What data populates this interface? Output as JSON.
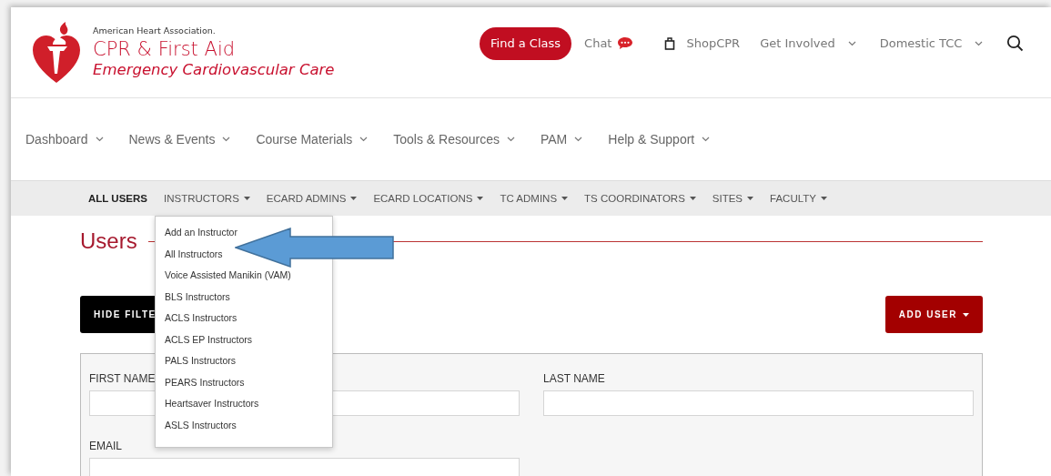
{
  "logo": {
    "org": "American Heart Association.",
    "title": "CPR & First Aid",
    "subtitle": "Emergency Cardiovascular Care"
  },
  "top_nav": [
    {
      "kind": "button",
      "label": "Find a Class"
    },
    {
      "kind": "chat",
      "label": "Chat"
    },
    {
      "kind": "shop",
      "label": "ShopCPR"
    },
    {
      "kind": "menu",
      "label": "Get Involved"
    },
    {
      "kind": "menu",
      "label": "Domestic TCC"
    },
    {
      "kind": "search"
    }
  ],
  "main_nav": [
    "Dashboard",
    "News & Events",
    "Course Materials",
    "Tools & Resources",
    "PAM",
    "Help & Support"
  ],
  "sub_nav": [
    {
      "label": "ALL USERS",
      "selected": true,
      "has_menu": false,
      "expanded": false
    },
    {
      "label": "INSTRUCTORS",
      "selected": false,
      "has_menu": true,
      "expanded": true,
      "menu_items": [
        "Add an Instructor",
        "All Instructors",
        "Voice Assisted Manikin (VAM)",
        "BLS Instructors",
        "ACLS Instructors",
        "ACLS EP Instructors",
        "PALS Instructors",
        "PEARS Instructors",
        "Heartsaver Instructors",
        "ASLS Instructors"
      ]
    },
    {
      "label": "ECARD ADMINS",
      "selected": false,
      "has_menu": true,
      "expanded": false
    },
    {
      "label": "ECARD LOCATIONS",
      "selected": false,
      "has_menu": true,
      "expanded": false
    },
    {
      "label": "TC ADMINS",
      "selected": false,
      "has_menu": true,
      "expanded": false
    },
    {
      "label": "TS COORDINATORS",
      "selected": false,
      "has_menu": true,
      "expanded": false
    },
    {
      "label": "SITES",
      "selected": false,
      "has_menu": true,
      "expanded": false
    },
    {
      "label": "FACULTY",
      "selected": false,
      "has_menu": true,
      "expanded": false
    }
  ],
  "page_title": "Users",
  "buttons": [
    {
      "kind": "dark",
      "label": "HIDE FILTE",
      "caret": false
    },
    {
      "kind": "primary",
      "label": "ADD USER",
      "caret": true
    }
  ],
  "filters": [
    {
      "label": "FIRST NAME"
    },
    {
      "label": "LAST NAME"
    },
    {
      "label": "EMAIL"
    }
  ]
}
